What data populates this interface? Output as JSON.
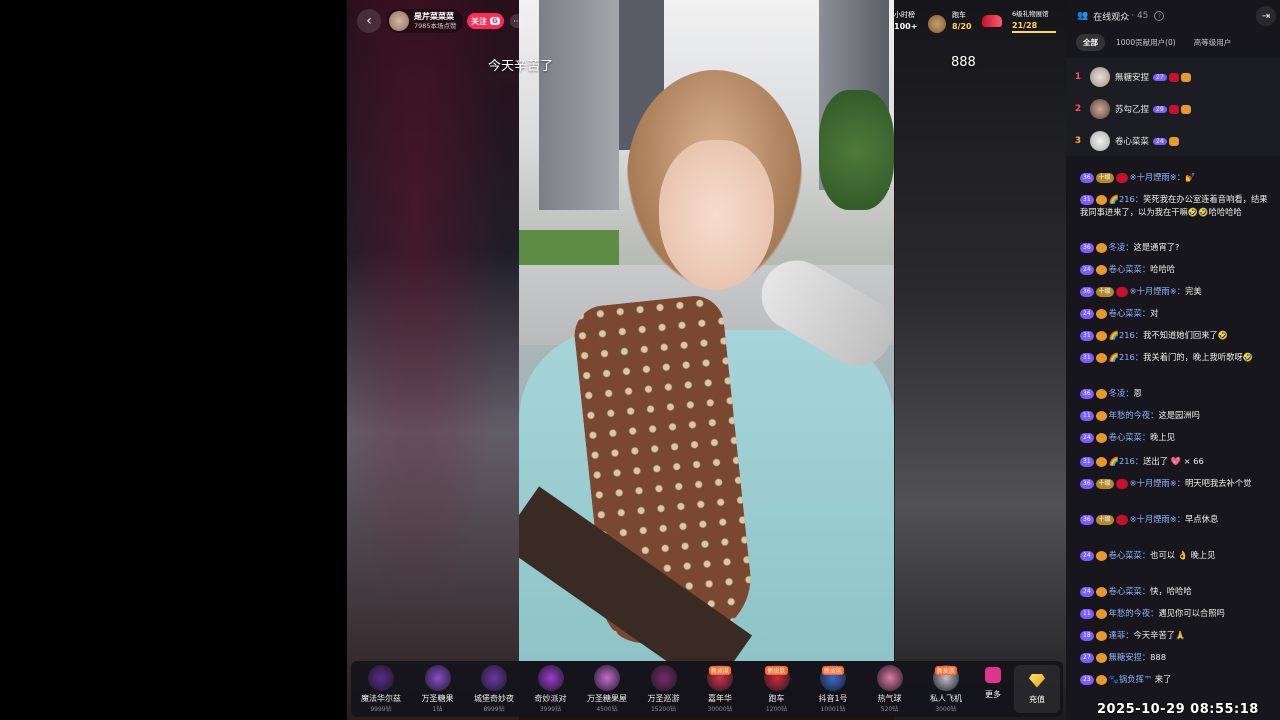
{
  "stream": {
    "anchor_name": "是芹菜菜菜",
    "anchor_sub": "7985本场点赞",
    "follow_label": "关注",
    "follow_badge": "G",
    "floating_left": "今天辛苦了",
    "floating_right": "888"
  },
  "top_stats": {
    "hour_rank_label": "小时榜",
    "hour_rank_value": "100+",
    "car_label": "跑车",
    "car_value": "8/20",
    "club_label": "6级礼物展馆",
    "club_value": "21/28"
  },
  "gifts": [
    {
      "name": "魔法华尔兹",
      "price": "9999钻",
      "color": "#5a2a8c",
      "tag": ""
    },
    {
      "name": "万圣糖果",
      "price": "1钻",
      "color": "#8a4fd0",
      "tag": ""
    },
    {
      "name": "城堡奇妙夜",
      "price": "8999钻",
      "color": "#6a3aa8",
      "tag": ""
    },
    {
      "name": "奇妙派对",
      "price": "3999钻",
      "color": "#a03ad0",
      "tag": ""
    },
    {
      "name": "万圣糖果屋",
      "price": "4500钻",
      "color": "#c86ad0",
      "tag": ""
    },
    {
      "name": "万圣巡游",
      "price": "15200钻",
      "color": "#7a2a6a",
      "tag": ""
    },
    {
      "name": "嘉年华",
      "price": "30000钻",
      "color": "#d0304a",
      "tag": "新皮肤"
    },
    {
      "name": "跑车",
      "price": "1200钻",
      "color": "#d02a3a",
      "tag": "新皮肤"
    },
    {
      "name": "抖音1号",
      "price": "10001钻",
      "color": "#3a6ad0",
      "tag": "新皮肤"
    },
    {
      "name": "热气球",
      "price": "520钻",
      "color": "#e07aa0",
      "tag": ""
    },
    {
      "name": "私人飞机",
      "price": "3000钻",
      "color": "#c0c0c8",
      "tag": "新皮肤"
    }
  ],
  "gift_more": "更多",
  "recharge_label": "充值",
  "panel": {
    "title": "在线观众",
    "count": "· 45",
    "exit_icon": "exit-icon",
    "tabs": [
      "全部",
      "1000贡献用户(0)",
      "高等级用户"
    ],
    "ranks": [
      {
        "num": "1",
        "name": "無糖安捏",
        "lv": "27"
      },
      {
        "num": "2",
        "name": "苏勾乙捏",
        "lv": "29"
      },
      {
        "num": "3",
        "name": "卷心菜菜",
        "lv": "24"
      }
    ]
  },
  "chat": [
    {
      "lv": "36",
      "tag": "十级",
      "user": "※十月煙雨※：",
      "text": "💅"
    },
    {
      "lv": "31",
      "tag": "",
      "user": "🌈216：",
      "text": "笑死我在办公室连着音响看，结果我同事进来了，以为我在干嘛🤣🤣哈哈哈哈"
    },
    {
      "lv": "36",
      "tag": "",
      "user": "冬凌：",
      "text": "这是通宵了?"
    },
    {
      "lv": "24",
      "tag": "",
      "user": "卷心菜菜：",
      "text": "哈哈哈"
    },
    {
      "lv": "36",
      "tag": "十级",
      "user": "※十月煙雨※：",
      "text": "完美"
    },
    {
      "lv": "24",
      "tag": "",
      "user": "卷心菜菜：",
      "text": "对"
    },
    {
      "lv": "31",
      "tag": "",
      "user": "🌈216：",
      "text": "我不知道她们回来了🤣"
    },
    {
      "lv": "31",
      "tag": "",
      "user": "🌈216：",
      "text": "我关着门的，晚上我听歌呀🤣"
    },
    {
      "lv": "36",
      "tag": "",
      "user": "冬凌：",
      "text": "恩"
    },
    {
      "lv": "11",
      "tag": "",
      "user": "年愁的今夜：",
      "text": "这是园洲吗"
    },
    {
      "lv": "24",
      "tag": "",
      "user": "卷心菜菜：",
      "text": "晚上见"
    },
    {
      "lv": "31",
      "tag": "",
      "user": "🌈216：",
      "text": "送出了 💖 × 66"
    },
    {
      "lv": "36",
      "tag": "十级",
      "user": "※十月煙雨※：",
      "text": "明天吧我去补个觉"
    },
    {
      "lv": "36",
      "tag": "十级",
      "user": "※十月煙雨※：",
      "text": "早点休息"
    },
    {
      "lv": "24",
      "tag": "",
      "user": "卷心菜菜：",
      "text": "也可以 👌 晚上见"
    },
    {
      "lv": "24",
      "tag": "",
      "user": "卷心菜菜：",
      "text": "快，哈哈哈"
    },
    {
      "lv": "11",
      "tag": "",
      "user": "年愁的今夜：",
      "text": "遇见你可以合照吗"
    },
    {
      "lv": "18",
      "tag": "",
      "user": "達菲：",
      "text": "今天辛苦了🙏"
    },
    {
      "lv": "27",
      "tag": "",
      "user": "無糖安捏：",
      "text": "888"
    },
    {
      "lv": "23",
      "tag": "",
      "user": "🐾锅负挥™ ",
      "text": "来了"
    }
  ],
  "clock": "2025-10-29 08:55:18"
}
